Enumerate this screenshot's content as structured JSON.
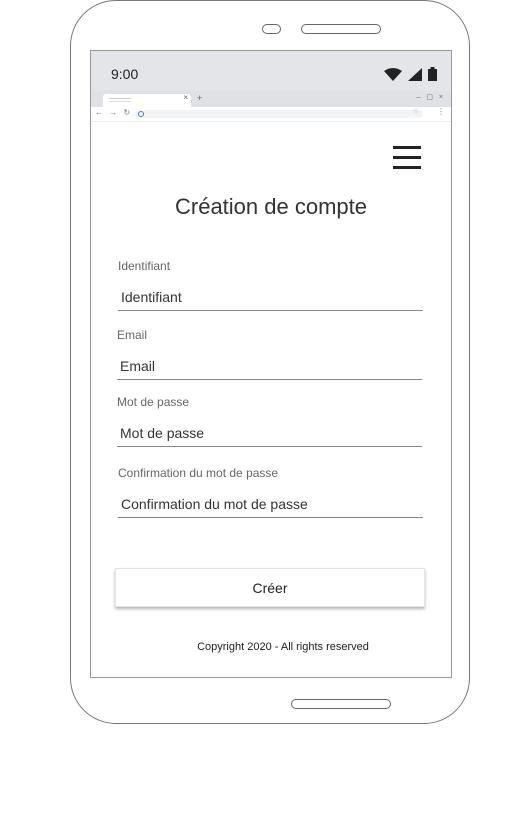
{
  "status_bar": {
    "time": "9:00"
  },
  "browser": {
    "close_tab": "×",
    "new_tab": "+",
    "window_controls": "– ▢ ×",
    "nav": "← → ↻",
    "star": "☆",
    "menu": "⋮"
  },
  "page": {
    "title": "Création de compte",
    "fields": [
      {
        "label": "Identifiant",
        "placeholder": "Identifiant"
      },
      {
        "label": "Email",
        "placeholder": "Email"
      },
      {
        "label": "Mot de passe",
        "placeholder": "Mot de passe"
      },
      {
        "label": "Confirmation du mot de passe",
        "placeholder": "Confirmation du mot de passe"
      }
    ],
    "submit_label": "Créer",
    "footer": "Copyright 2020 - All rights reserved"
  },
  "icons": {
    "wifi": "wifi-icon",
    "signal": "signal-icon",
    "battery": "battery-icon",
    "menu": "hamburger-menu-icon"
  }
}
